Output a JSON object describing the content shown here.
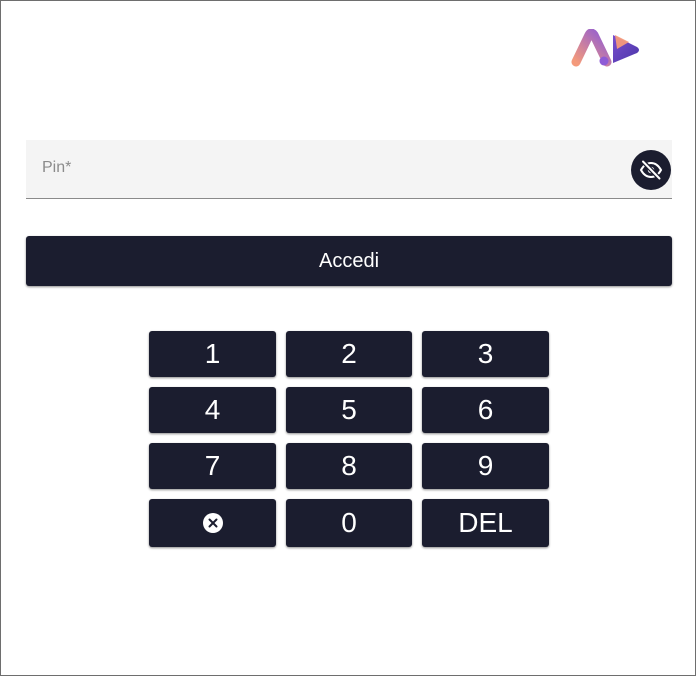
{
  "logo": {
    "icon": "brand-logo-icon",
    "colors": [
      "#f49a7b",
      "#8e5bd6",
      "#5a3fb6"
    ]
  },
  "pin": {
    "label": "Pin*",
    "toggle_icon": "eye-off-icon"
  },
  "login": {
    "label": "Accedi"
  },
  "keypad": {
    "keys": [
      "1",
      "2",
      "3",
      "4",
      "5",
      "6",
      "7",
      "8",
      "9"
    ],
    "clear_icon": "clear-circle-icon",
    "zero": "0",
    "delete": "DEL"
  },
  "colors": {
    "button_bg": "#1b1d2f",
    "field_bg": "#f4f4f4",
    "placeholder": "#8b8b8b"
  }
}
